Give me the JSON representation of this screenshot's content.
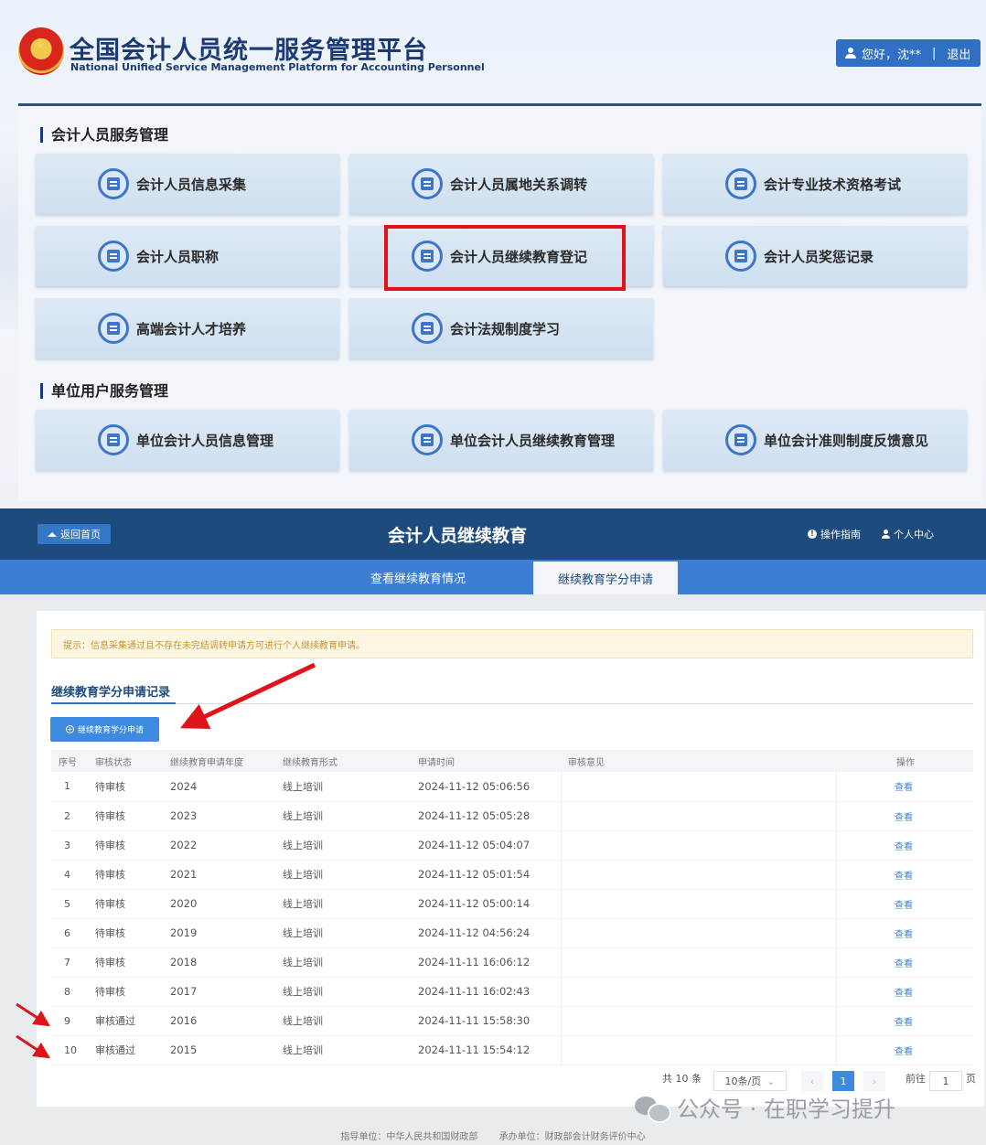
{
  "portal": {
    "title": "全国会计人员统一服务管理平台",
    "subtitle": "National Unified Service Management Platform for Accounting Personnel",
    "user_greeting": "您好，沈**",
    "separator": "|",
    "logout": "退出",
    "sections": [
      {
        "title": "会计人员服务管理",
        "cards": [
          {
            "label": "会计人员信息采集",
            "icon": "edit-doc-icon"
          },
          {
            "label": "会计人员属地关系调转",
            "icon": "location-transfer-icon"
          },
          {
            "label": "会计专业技术资格考试",
            "icon": "exam-icon"
          },
          {
            "label": "会计人员职称",
            "icon": "certificate-icon"
          },
          {
            "label": "会计人员继续教育登记",
            "icon": "education-register-icon"
          },
          {
            "label": "会计人员奖惩记录",
            "icon": "record-icon"
          },
          {
            "label": "高端会计人才培养",
            "icon": "graduation-cap-icon"
          },
          {
            "label": "会计法规制度学习",
            "icon": "play-video-icon"
          }
        ]
      },
      {
        "title": "单位用户服务管理",
        "cards": [
          {
            "label": "单位会计人员信息管理",
            "icon": "unit-info-icon"
          },
          {
            "label": "单位会计人员继续教育管理",
            "icon": "unit-education-icon"
          },
          {
            "label": "单位会计准则制度反馈意见",
            "icon": "feedback-icon"
          }
        ]
      }
    ]
  },
  "app": {
    "home_button": "返回首页",
    "title": "会计人员继续教育",
    "guide": "操作指南",
    "personal_center": "个人中心",
    "tabs": [
      "查看继续教育情况",
      "继续教育学分申请"
    ],
    "notice": "提示：信息采集通过且不存在未完结调转申请方可进行个人继续教育申请。",
    "records_title": "继续教育学分申请记录",
    "apply_button": "继续教育学分申请",
    "table": {
      "headers": [
        "序号",
        "审核状态",
        "继续教育申请年度",
        "继续教育形式",
        "申请时间",
        "审核意见",
        "操作"
      ],
      "rows": [
        [
          "1",
          "待审核",
          "2024",
          "线上培训",
          "2024-11-12 05:06:56",
          "",
          "查看"
        ],
        [
          "2",
          "待审核",
          "2023",
          "线上培训",
          "2024-11-12 05:05:28",
          "",
          "查看"
        ],
        [
          "3",
          "待审核",
          "2022",
          "线上培训",
          "2024-11-12 05:04:07",
          "",
          "查看"
        ],
        [
          "4",
          "待审核",
          "2021",
          "线上培训",
          "2024-11-12 05:01:54",
          "",
          "查看"
        ],
        [
          "5",
          "待审核",
          "2020",
          "线上培训",
          "2024-11-12 05:00:14",
          "",
          "查看"
        ],
        [
          "6",
          "待审核",
          "2019",
          "线上培训",
          "2024-11-12 04:56:24",
          "",
          "查看"
        ],
        [
          "7",
          "待审核",
          "2018",
          "线上培训",
          "2024-11-11 16:06:12",
          "",
          "查看"
        ],
        [
          "8",
          "待审核",
          "2017",
          "线上培训",
          "2024-11-11 16:02:43",
          "",
          "查看"
        ],
        [
          "9",
          "审核通过",
          "2016",
          "线上培训",
          "2024-11-11 15:58:30",
          "",
          "查看"
        ],
        [
          "10",
          "审核通过",
          "2015",
          "线上培训",
          "2024-11-11 15:54:12",
          "",
          "查看"
        ]
      ]
    },
    "pager": {
      "total": "共 10 条",
      "page_size": "10条/页",
      "prev": "‹",
      "current_page": "1",
      "next": "›",
      "goto_label": "前往",
      "goto_value": "1",
      "page_suffix": "页"
    },
    "footer": {
      "guide_unit": "指导单位：中华人民共和国财政部",
      "host_unit": "承办单位：财政部会计财务评价中心"
    }
  },
  "watermark": {
    "text": "公众号 · 在职学习提升"
  },
  "colors": {
    "brand_navy": "#1e4b7e",
    "tab_blue": "#3b7ed3",
    "highlight_red": "#e0121a",
    "link_blue": "#3d7fd6",
    "notice_text": "#c9962b"
  }
}
